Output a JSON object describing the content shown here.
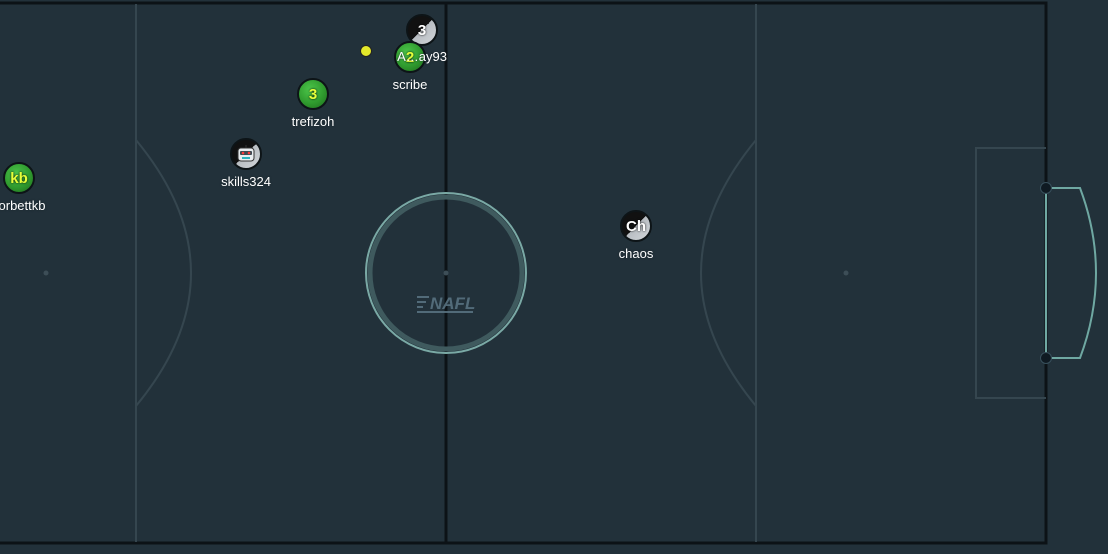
{
  "stadium": {
    "logo_text": "NAFL",
    "colors": {
      "background": "#22313a",
      "pitch_line": "#35464f",
      "boundary": "#0c1216",
      "goal_line": "#6fa8a2",
      "center_circle": "#7aa9a5",
      "ball": "#e3e82a"
    }
  },
  "players": [
    {
      "name": "scribe",
      "avatar": "2",
      "team": "blue"
    },
    {
      "name": "trefizoh",
      "avatar": "3",
      "team": "blue"
    },
    {
      "name": "skills324",
      "avatar": "robot-emoji-icon",
      "team": "red"
    },
    {
      "name": "orbettkb",
      "avatar": "kb",
      "team": "blue"
    },
    {
      "name": "chaos",
      "avatar": "Ch",
      "team": "red"
    },
    {
      "name": "A…ay93",
      "avatar": "3",
      "team": "red"
    }
  ]
}
